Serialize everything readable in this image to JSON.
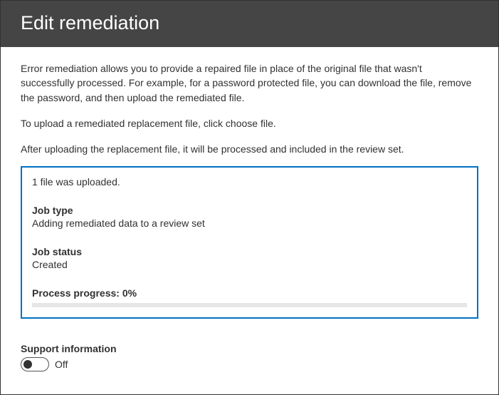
{
  "header": {
    "title": "Edit remediation"
  },
  "content": {
    "description": "Error remediation allows you to provide a repaired file in place of the original file that wasn't successfully processed. For example, for a password protected file, you can download the file, remove the password, and then upload the remediated file.",
    "instruction": "To upload a remediated replacement file, click choose file.",
    "note": "After uploading the replacement file, it will be processed and included in the review set."
  },
  "status": {
    "upload_msg": "1 file was uploaded.",
    "job_type_label": "Job type",
    "job_type_value": "Adding remediated data to a review set",
    "job_status_label": "Job status",
    "job_status_value": "Created",
    "progress_label": "Process progress: 0%",
    "progress_percent": 0
  },
  "support": {
    "label": "Support information",
    "toggle_state": "Off",
    "toggle_on": false
  }
}
